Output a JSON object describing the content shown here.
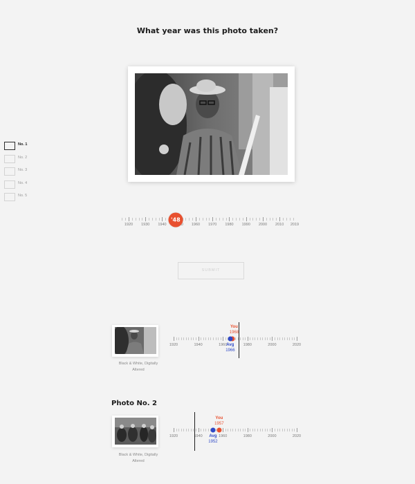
{
  "question": "What year was this photo taken?",
  "photo_nav": [
    {
      "label": "No. 1",
      "active": true
    },
    {
      "label": "No. 2",
      "active": false
    },
    {
      "label": "No. 3",
      "active": false
    },
    {
      "label": "No. 4",
      "active": false
    },
    {
      "label": "No. 5",
      "active": false
    }
  ],
  "slider": {
    "min_year": 1915,
    "max_year": 2019,
    "tick_labels": [
      "1920",
      "1930",
      "1940",
      "1950",
      "1960",
      "1970",
      "1980",
      "1990",
      "2000",
      "2010",
      "2019"
    ],
    "thumb_label": "'48",
    "thumb_year": 1948
  },
  "submit_label": "SUBMIT",
  "results": [
    {
      "title": "",
      "caption_line1": "Black & White, Digitally",
      "caption_line2": "Altered",
      "tick_labels": [
        "1920",
        "1940",
        "1960",
        "1980",
        "2000",
        "2020"
      ],
      "you_label": "You",
      "you_year": "1968",
      "avg_label": "Avg",
      "avg_year": "1966",
      "actual_year": 1973
    },
    {
      "title": "Photo No. 2",
      "caption_line1": "Black & White, Digitally",
      "caption_line2": "Altered",
      "tick_labels": [
        "1920",
        "1940",
        "1960",
        "1980",
        "2000",
        "2020"
      ],
      "you_label": "You",
      "you_year": "1957",
      "avg_label": "Avg",
      "avg_year": "1952",
      "actual_year": 1937
    }
  ],
  "colors": {
    "you": "#e8502f",
    "avg": "#2f49c6",
    "thumb": "#e8502f"
  }
}
